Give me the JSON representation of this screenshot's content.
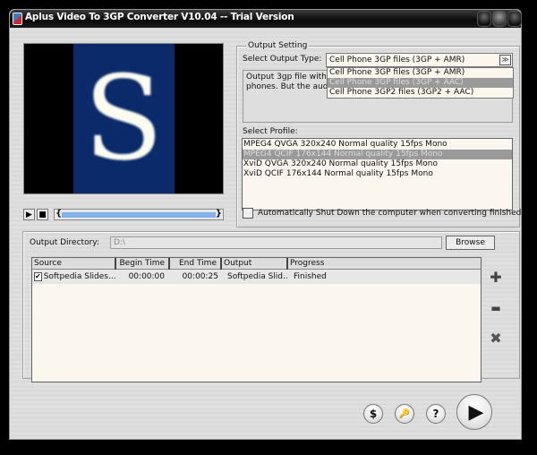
{
  "window": {
    "title": "Aplus Video To 3GP Converter V10.04 -- Trial Version"
  },
  "preview": {
    "frame_letter": "S"
  },
  "player": {
    "play_icon": "play-icon",
    "stop_icon": "stop-icon",
    "left_bracket": "{",
    "right_bracket": "}"
  },
  "output_setting": {
    "group_title": "Output Setting",
    "output_type_label": "Select Output Type:",
    "output_type_value": "Cell Phone 3GP  files (3GP + AMR)",
    "description": "Output 3gp file with AMR audio, compatible with most cell phones. But the audio quality is not good.",
    "description_visible": "Output 3gp file with AM\nphones. But the audio",
    "dropdown_options": [
      {
        "label": "Cell Phone 3GP  files (3GP + AMR)",
        "selected": false
      },
      {
        "label": "Cell Phone 3GP  files (3GP + AAC)",
        "selected": true
      },
      {
        "label": "Cell Phone 3GP2 files (3GP2 + AAC)",
        "selected": false
      }
    ],
    "profile_label": "Select Profile:",
    "profiles": [
      {
        "label": "MPEG4 QVGA 320x240 Normal quality 15fps Mono",
        "selected": false
      },
      {
        "label": "MPEG4 QCIF 176x144 Normal quality 15fps Mono",
        "selected": true
      },
      {
        "label": "XviD  QVGA 320x240 Normal quality 15fps Mono",
        "selected": false
      },
      {
        "label": "XviD  QCIF 176x144 Normal quality 15fps Mono",
        "selected": false
      }
    ],
    "shutdown_label": "Automatically Shut Down the computer when converting finished",
    "shutdown_checked": false
  },
  "output": {
    "directory_label": "Output Directory:",
    "directory_value": "D:\\",
    "browse_label": "Browse"
  },
  "file_list": {
    "columns": [
      "Source",
      "Begin Time",
      "End Time",
      "Output",
      "Progress"
    ],
    "rows": [
      {
        "checked": true,
        "checkmark": "✔",
        "source": "Softpedia Slides...",
        "begin": "00:00:00",
        "end": "00:00:25",
        "output": "Softpedia Slid...",
        "progress": "Finished"
      }
    ]
  },
  "side_actions": {
    "add": "✚",
    "remove": "▬",
    "clear": "✖"
  },
  "bottom_buttons": {
    "buy": "$",
    "register": "🔑",
    "help": "?",
    "start": "▶"
  }
}
